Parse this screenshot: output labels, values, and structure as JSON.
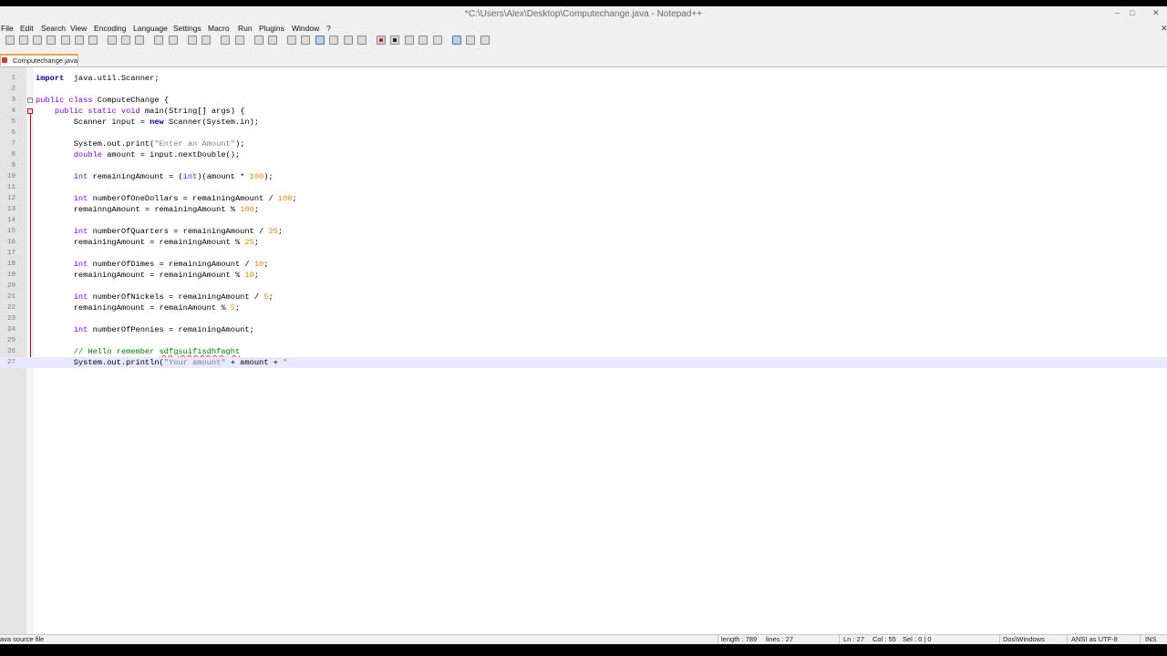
{
  "window": {
    "title": "*C:\\Users\\Alex\\Desktop\\Computechange.java - Notepad++",
    "controls": {
      "minimize": "–",
      "maximize": "□",
      "close": "✕"
    }
  },
  "menu": {
    "items": [
      "File",
      "Edit",
      "Search",
      "View",
      "Encoding",
      "Language",
      "Settings",
      "Macro",
      "Run",
      "Plugins",
      "Window",
      "?"
    ],
    "close_glyph": "✕"
  },
  "toolbar": {
    "icons": [
      "new-file-icon",
      "open-file-icon",
      "save-icon",
      "save-all-icon",
      "close-icon",
      "close-all-icon",
      "print-icon",
      "cut-icon",
      "copy-icon",
      "paste-icon",
      "undo-icon",
      "redo-icon",
      "find-icon",
      "replace-icon",
      "zoom-in-icon",
      "zoom-out-icon",
      "sync-vertical-icon",
      "sync-horizontal-icon",
      "word-wrap-icon",
      "show-all-chars-icon",
      "indent-guide-icon",
      "udl-icon",
      "doc-map-icon",
      "function-list-icon",
      "folder-as-workspace-icon",
      "monitoring-icon",
      "record-macro-icon",
      "stop-recording-icon",
      "playback-macro-icon",
      "run-macro-multiple-icon",
      "save-macro-icon",
      "ds-icon",
      "launch-in-browser-icon",
      "spell-check-icon"
    ],
    "pressed": [
      "word-wrap-icon",
      "ds-icon"
    ],
    "record_color": "#cc1111"
  },
  "tabs": [
    {
      "label": "Computechange.java",
      "modified": true,
      "accent": "#f3a24d"
    }
  ],
  "editor": {
    "current_line": 27,
    "lines": [
      {
        "n": "1",
        "parts": [
          [
            "kw",
            "import"
          ],
          [
            "",
            "  java.util.Scanner;"
          ]
        ]
      },
      {
        "n": "2",
        "parts": []
      },
      {
        "n": "3",
        "parts": [
          [
            "kw2",
            "public"
          ],
          [
            "",
            " "
          ],
          [
            "kw2",
            "class"
          ],
          [
            "",
            " ComputeChange {"
          ]
        ]
      },
      {
        "n": "4",
        "parts": [
          [
            "",
            "    "
          ],
          [
            "kw2",
            "public"
          ],
          [
            "",
            " "
          ],
          [
            "kw2",
            "static"
          ],
          [
            "",
            " "
          ],
          [
            "kw2",
            "void"
          ],
          [
            "",
            " main(String[] args) {"
          ]
        ]
      },
      {
        "n": "5",
        "parts": [
          [
            "",
            "        Scanner input = "
          ],
          [
            "kw",
            "new"
          ],
          [
            "",
            " Scanner(System.in);"
          ]
        ]
      },
      {
        "n": "6",
        "parts": []
      },
      {
        "n": "7",
        "parts": [
          [
            "",
            "        System.out.print("
          ],
          [
            "str",
            "\"Enter an Amount\""
          ],
          [
            "",
            ");"
          ]
        ]
      },
      {
        "n": "8",
        "parts": [
          [
            "",
            "        "
          ],
          [
            "kw2",
            "double"
          ],
          [
            "",
            " amount = input.nextDouble();"
          ]
        ]
      },
      {
        "n": "9",
        "parts": []
      },
      {
        "n": "10",
        "parts": [
          [
            "",
            "        "
          ],
          [
            "kw2",
            "int"
          ],
          [
            "",
            " remainingAmount = ("
          ],
          [
            "kw2",
            "int"
          ],
          [
            "",
            ")(amount * "
          ],
          [
            "num",
            "100"
          ],
          [
            "",
            ");"
          ]
        ]
      },
      {
        "n": "11",
        "parts": []
      },
      {
        "n": "12",
        "parts": [
          [
            "",
            "        "
          ],
          [
            "kw2",
            "int"
          ],
          [
            "",
            " numberOfOneDollars = remainingAmount / "
          ],
          [
            "num",
            "100"
          ],
          [
            "",
            ";"
          ]
        ]
      },
      {
        "n": "13",
        "parts": [
          [
            "",
            "        remainngAmount = remainingAmount % "
          ],
          [
            "num",
            "100"
          ],
          [
            "",
            ";"
          ]
        ]
      },
      {
        "n": "14",
        "parts": []
      },
      {
        "n": "15",
        "parts": [
          [
            "",
            "        "
          ],
          [
            "kw2",
            "int"
          ],
          [
            "",
            " numberOfQuarters = remainingAmount / "
          ],
          [
            "num",
            "25"
          ],
          [
            "",
            ";"
          ]
        ]
      },
      {
        "n": "16",
        "parts": [
          [
            "",
            "        remainingAmount = remainingAmount % "
          ],
          [
            "num",
            "25"
          ],
          [
            "",
            ";"
          ]
        ]
      },
      {
        "n": "17",
        "parts": []
      },
      {
        "n": "18",
        "parts": [
          [
            "",
            "        "
          ],
          [
            "kw2",
            "int"
          ],
          [
            "",
            " numberOfDimes = remainingAmount / "
          ],
          [
            "num",
            "10"
          ],
          [
            "",
            ";"
          ]
        ]
      },
      {
        "n": "19",
        "parts": [
          [
            "",
            "        remainingAmount = remainingAmount % "
          ],
          [
            "num",
            "10"
          ],
          [
            "",
            ";"
          ]
        ]
      },
      {
        "n": "20",
        "parts": []
      },
      {
        "n": "21",
        "parts": [
          [
            "",
            "        "
          ],
          [
            "kw2",
            "int"
          ],
          [
            "",
            " numberOfNickels = remainingAmount / "
          ],
          [
            "num",
            "5"
          ],
          [
            "",
            ";"
          ]
        ]
      },
      {
        "n": "22",
        "parts": [
          [
            "",
            "        remainingAmount = remainAmount % "
          ],
          [
            "num",
            "5"
          ],
          [
            "",
            ";"
          ]
        ]
      },
      {
        "n": "23",
        "parts": []
      },
      {
        "n": "24",
        "parts": [
          [
            "",
            "        "
          ],
          [
            "kw2",
            "int"
          ],
          [
            "",
            " numberOfPennies = remainingAmount;"
          ]
        ]
      },
      {
        "n": "25",
        "parts": []
      },
      {
        "n": "26",
        "parts": [
          [
            "",
            "        "
          ],
          [
            "cmt",
            "// Hello remember "
          ],
          [
            "cmt squiggle",
            "sdfgsuifisdhfaght"
          ]
        ]
      },
      {
        "n": "27",
        "parts": [
          [
            "",
            "        System.out.println("
          ],
          [
            "str",
            "\"Your amount\""
          ],
          [
            "",
            " + amount + "
          ],
          [
            "str",
            "\""
          ]
        ]
      }
    ]
  },
  "status": {
    "file_type": "ava source file",
    "length": "length : 789",
    "lines": "lines : 27",
    "ln": "Ln : 27",
    "col": "Col : 55",
    "sel": "Sel : 0 | 0",
    "eol": "Dos\\Windows",
    "encoding": "ANSI as UTF-8",
    "mode": "INS"
  }
}
